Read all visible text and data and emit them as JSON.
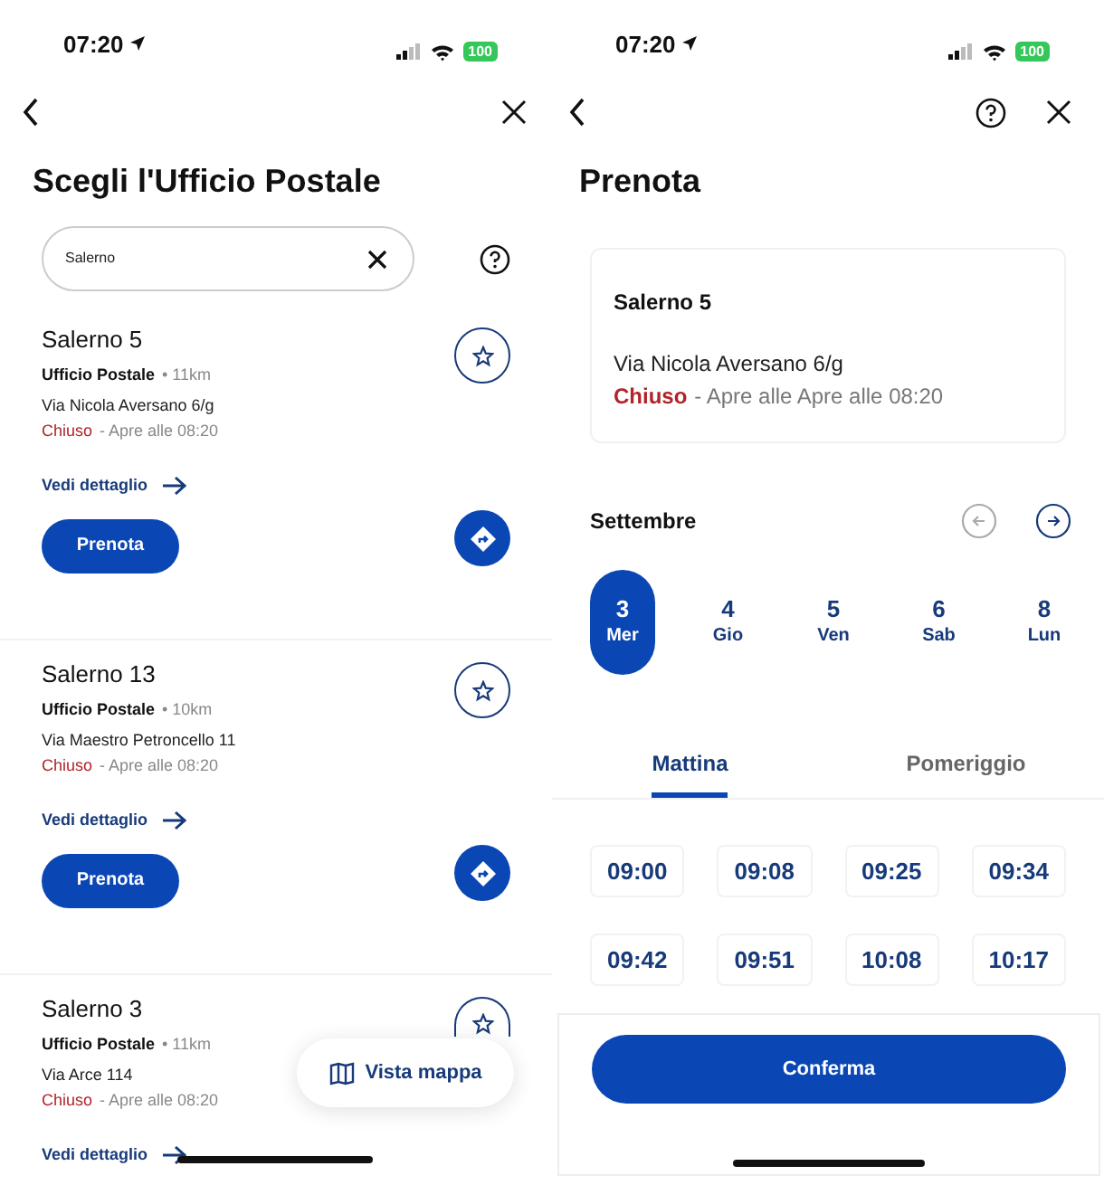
{
  "left_screen": {
    "status_bar": {
      "time": "07:20",
      "battery": "100"
    },
    "title": "Scegli l'Ufficio Postale",
    "search": {
      "value": "Salerno"
    },
    "offices": [
      {
        "name": "Salerno 5",
        "type": "Ufficio Postale",
        "distance": "• 11km",
        "address": "Via Nicola Aversano 6/g",
        "status": "Chiuso",
        "opening": "- Apre alle 08:20",
        "detail_link": "Vedi dettaglio",
        "book_button": "Prenota"
      },
      {
        "name": "Salerno 13",
        "type": "Ufficio Postale",
        "distance": "• 10km",
        "address": "Via Maestro Petroncello 11",
        "status": "Chiuso",
        "opening": "- Apre alle 08:20",
        "detail_link": "Vedi dettaglio",
        "book_button": "Prenota"
      },
      {
        "name": "Salerno 3",
        "type": "Ufficio Postale",
        "distance": "• 11km",
        "address": "Via Arce 114",
        "status": "Chiuso",
        "opening": "- Apre alle 08:20",
        "detail_link": "Vedi dettaglio"
      }
    ],
    "map_button": "Vista mappa"
  },
  "right_screen": {
    "status_bar": {
      "time": "07:20",
      "battery": "100"
    },
    "title": "Prenota",
    "office": {
      "name": "Salerno 5",
      "address": "Via Nicola Aversano 6/g",
      "status": "Chiuso",
      "opening": "- Apre alle Apre alle 08:20"
    },
    "month": "Settembre",
    "days": [
      {
        "number": "3",
        "weekday": "Mer",
        "selected": true
      },
      {
        "number": "4",
        "weekday": "Gio",
        "selected": false
      },
      {
        "number": "5",
        "weekday": "Ven",
        "selected": false
      },
      {
        "number": "6",
        "weekday": "Sab",
        "selected": false
      },
      {
        "number": "8",
        "weekday": "Lun",
        "selected": false
      }
    ],
    "tabs": [
      {
        "label": "Mattina",
        "selected": true
      },
      {
        "label": "Pomeriggio",
        "selected": false
      }
    ],
    "time_slots": [
      "09:00",
      "09:08",
      "09:25",
      "09:34",
      "09:42",
      "09:51",
      "10:08",
      "10:17"
    ],
    "confirm_button": "Conferma"
  }
}
